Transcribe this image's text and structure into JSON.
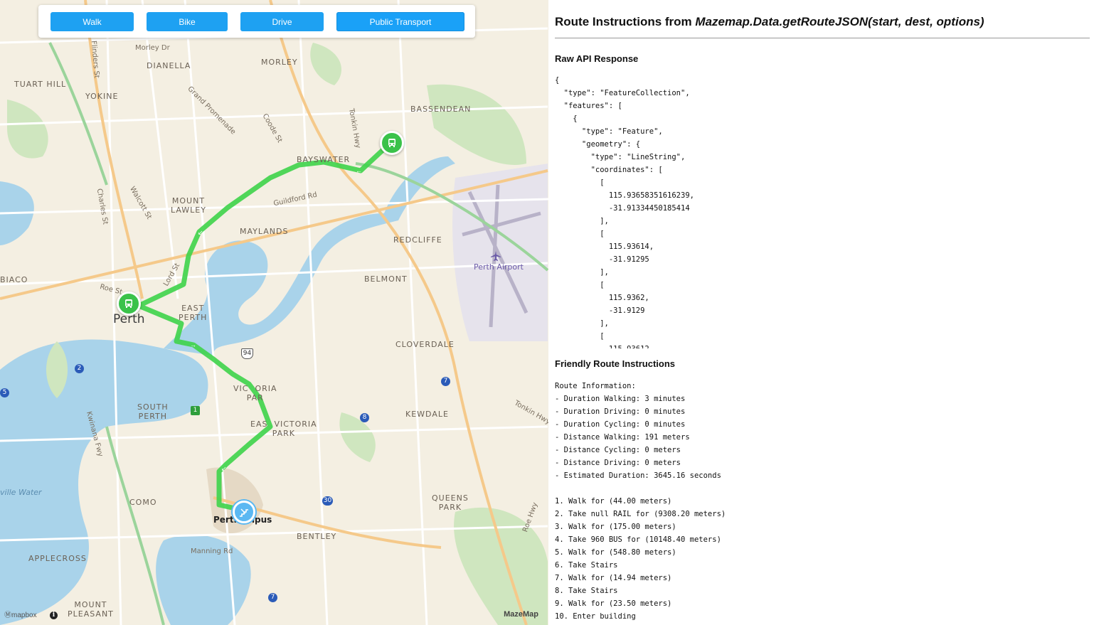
{
  "modes": [
    {
      "label": "Walk",
      "active": false
    },
    {
      "label": "Bike",
      "active": false
    },
    {
      "label": "Drive",
      "active": false
    },
    {
      "label": "Public Transport",
      "active": true
    }
  ],
  "map": {
    "labels": {
      "dianella": "DIANELLA",
      "morley": "MORLEY",
      "tuart_hill": "TUART HILL",
      "yokine": "YOKINE",
      "bassendean": "BASSENDEAN",
      "bayswater": "BAYSWATER",
      "mount_lawley": "MOUNT\nLAWLEY",
      "maylands": "MAYLANDS",
      "redcliffe": "REDCLIFFE",
      "biaco": "BIACO",
      "perth": "Perth",
      "east_perth": "EAST\nPERTH",
      "belmont": "BELMONT",
      "perth_airport": "Perth Airport",
      "cloverdale": "CLOVERDALE",
      "victoria_park": "VIC  ORIA\nPAR",
      "east_victoria_park": "EAS  VICTORIA\nPARK",
      "kewdale": "KEWDALE",
      "south_perth": "SOUTH\nPERTH",
      "como": "COMO",
      "queens_park": "QUEENS\nPARK",
      "perth_campus": "Perth  mpus",
      "bentley": "BENTLEY",
      "applecross": "APPLECROSS",
      "mount_pleasant": "MOUNT\nPLEASANT",
      "ville_water": "ville Water",
      "morley_dr": "Morley Dr",
      "grand_promenade": "Grand Promenade",
      "coode_st": "Coode St",
      "tonkin_hwy": "Tonkin Hwy",
      "tonkin_hwy2": "Tonkin Hwy",
      "guildford_rd": "Guildford Rd",
      "walcott_st": "Walcott St",
      "charles_st": "Charles St",
      "flinders_st": "Flinders St",
      "lord_st": "Lord St",
      "roe_st": "Roe St",
      "kwinana_fwy": "Kwinana Fwy",
      "manning_rd": "Manning Rd",
      "roe_hwy": "Roe Hwy"
    },
    "badges": {
      "b2": "2",
      "b5": "5",
      "b1": "1",
      "b94": "94",
      "b7a": "7",
      "b8": "8",
      "b30": "30",
      "b7b": "7"
    },
    "attribution_left": "Ⓜmapbox",
    "attribution_right": "MazeMap",
    "info_icon": "i"
  },
  "panel": {
    "title_prefix": "Route Instructions from ",
    "title_code": "Mazemap.Data.getRouteJSON(start, dest, options)",
    "raw_heading": "Raw API Response",
    "raw_json": "{\n  \"type\": \"FeatureCollection\",\n  \"features\": [\n    {\n      \"type\": \"Feature\",\n      \"geometry\": {\n        \"type\": \"LineString\",\n        \"coordinates\": [\n          [\n            115.93658351616239,\n            -31.91334450185414\n          ],\n          [\n            115.93614,\n            -31.91295\n          ],\n          [\n            115.9362,\n            -31.9129\n          ],\n          [\n            115.93612",
    "friendly_heading": "Friendly Route Instructions",
    "friendly_text": "Route Information:\n- Duration Walking: 3 minutes\n- Duration Driving: 0 minutes\n- Duration Cycling: 0 minutes\n- Distance Walking: 191 meters\n- Distance Cycling: 0 meters\n- Distance Driving: 0 meters\n- Estimated Duration: 3645.16 seconds\n\n1. Walk for (44.00 meters)\n2. Take null RAIL for (9308.20 meters)\n3. Walk for (175.00 meters)\n4. Take 960 BUS for (10148.40 meters)\n5. Walk for (548.80 meters)\n6. Take Stairs\n7. Walk for (14.94 meters)\n8. Take Stairs\n9. Walk for (23.50 meters)\n10. Enter building"
  },
  "colors": {
    "route": "#3ed34a",
    "button": "#1ea1f2",
    "water": "#a9d3ea",
    "park": "#cfe6bf"
  }
}
